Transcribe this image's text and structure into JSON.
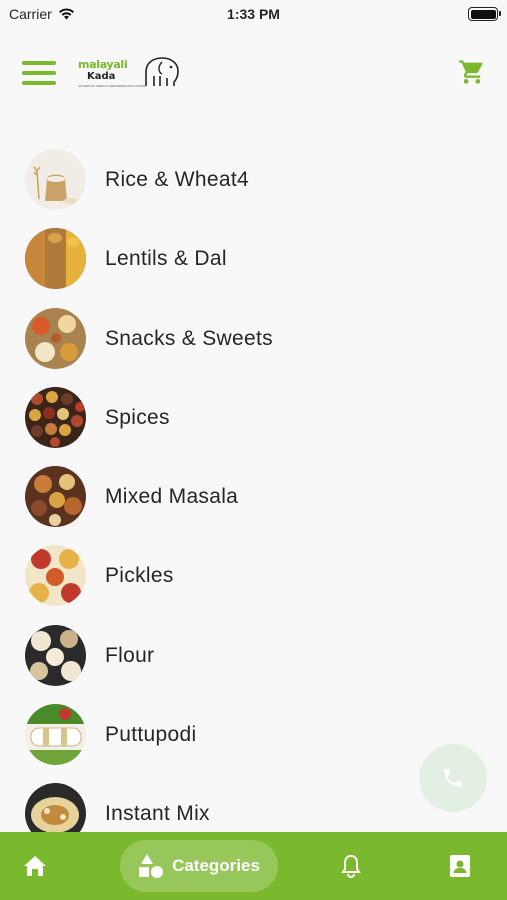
{
  "status_bar": {
    "carrier": "Carrier",
    "time": "1:33 PM"
  },
  "header": {
    "logo": {
      "line1": "malayali",
      "line2": "Kada",
      "tagline": "AUTHENTIC KERALA GROCERIES AND FOODS"
    },
    "menu_icon": "hamburger-icon",
    "cart_icon": "shopping-cart-icon"
  },
  "categories": [
    {
      "label": "Rice & Wheat4",
      "thumb_colors": [
        "#e9dcc1",
        "#c9a36a",
        "#f3ece0"
      ]
    },
    {
      "label": "Lentils & Dal",
      "thumb_colors": [
        "#c8863b",
        "#e6b23c",
        "#8a5a2b"
      ]
    },
    {
      "label": "Snacks & Sweets",
      "thumb_colors": [
        "#d89a3a",
        "#f0d7a0",
        "#b55d2a"
      ]
    },
    {
      "label": "Spices",
      "thumb_colors": [
        "#6d3b2a",
        "#b04a2f",
        "#d9a441"
      ]
    },
    {
      "label": "Mixed Masala",
      "thumb_colors": [
        "#8b4a2b",
        "#c97b3a",
        "#e3c27a"
      ]
    },
    {
      "label": "Pickles",
      "thumb_colors": [
        "#c0392b",
        "#e8b24a",
        "#f2e6c8"
      ]
    },
    {
      "label": "Flour",
      "thumb_colors": [
        "#efe6d4",
        "#c9b38a",
        "#2a2a2a"
      ]
    },
    {
      "label": "Puttupodi",
      "thumb_colors": [
        "#4a8a2a",
        "#f3efe3",
        "#c0392b"
      ]
    },
    {
      "label": "Instant Mix",
      "thumb_colors": [
        "#e7d29a",
        "#c28a3e",
        "#2a2a2a"
      ]
    }
  ],
  "fab": {
    "icon": "phone-icon"
  },
  "bottom_nav": {
    "home_icon": "home-icon",
    "categories_label": "Categories",
    "categories_icon": "categories-icon",
    "notifications_icon": "bell-icon",
    "profile_icon": "contact-card-icon"
  },
  "colors": {
    "accent": "#7ab82e",
    "background": "#f8f8f8",
    "text": "#262626"
  }
}
